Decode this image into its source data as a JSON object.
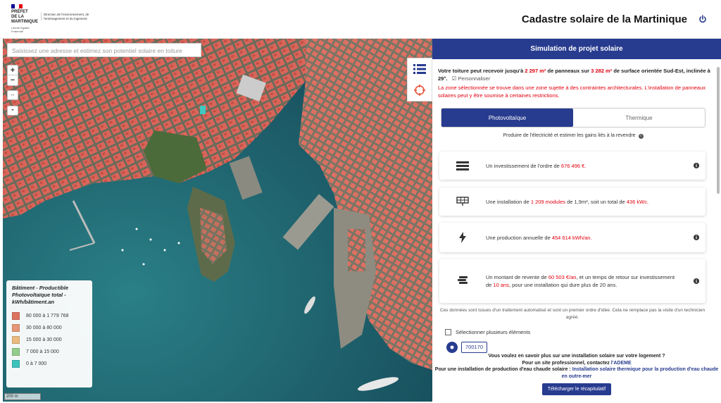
{
  "header": {
    "logo_line1": "PRÉFET",
    "logo_line2": "DE LA",
    "logo_line3": "MARTINIQUE",
    "logo_motto": "Liberté Égalité Fraternité",
    "logo_direction": "Direction de l'environnement, de l'aménagement et du logement",
    "title": "Cadastre solaire de la Martinique"
  },
  "map": {
    "search_placeholder": "Saisissez une adresse et estimez son potentiel solaire en toiture",
    "zoom_in": "+",
    "zoom_out": "−",
    "scale": "200 m",
    "legend": {
      "title": "Bâtiment - Productible Photovoltaïque total - kWh/bâtiment.an",
      "items": [
        {
          "label": "80 000 à 1 779 768",
          "color": "#e8735f"
        },
        {
          "label": "30 000 à 80 000",
          "color": "#f09a78"
        },
        {
          "label": "15 000 à 30 000",
          "color": "#f5bf80"
        },
        {
          "label": "7 000 à 15 000",
          "color": "#9bd28c"
        },
        {
          "label": "0 à 7 000",
          "color": "#3ec8c0"
        }
      ]
    }
  },
  "panel": {
    "title": "Simulation de projet solaire",
    "intro_prefix": "Votre toiture peut recevoir jusqu'à",
    "panels_area": "2 297 m²",
    "intro_mid": "de panneaux sur",
    "surface_area": "3 282 m²",
    "intro_suffix": "de surface orientée Sud-Est, inclinée à 29°.",
    "personalize": "Personnaliser",
    "warning": "La zone sélectionnée se trouve dans une zone sujette à des contraintes architecturales. L'installation de panneaux solaires peut y être soumise à certaines restrictions.",
    "tabs": [
      {
        "label": "Photovoltaïque"
      },
      {
        "label": "Thermique"
      }
    ],
    "tab_desc": "Produire de l'électricité et estimer les gains liés à la revendre",
    "cards": {
      "investment": {
        "prefix": "Un investissement de l'ordre de",
        "value": "676 496 €."
      },
      "installation": {
        "prefix": "Une installation de",
        "value1": "1 209 modules",
        "mid": "de 1,9m², soit un total de",
        "value2": "436 kWc."
      },
      "production": {
        "prefix": "Une production annuelle de",
        "value": "454 614 kWh/an."
      },
      "resale": {
        "prefix": "Un montant de revente de",
        "value1": "60 503 €/an",
        "mid": ", et un temps de retour sur investissement de",
        "value2": "10 ans",
        "suffix": ", pour une installation qui dure plus de 20 ans."
      }
    },
    "note": "Ces données sont issues d'un traitement automatisé et sont un premier ordre d'idée. Cela ne remplace pas la visite d'un technicien agréé.",
    "checkbox_label": "Sélectionner plusieurs éléments",
    "building_id": "700170",
    "footer": {
      "line1": "Vous voulez en savoir plus sur une installation solaire sur votre logement ?",
      "line2_prefix": "Pour un site professionnel, contactez",
      "line2_link": "l'ADEME",
      "line3_prefix": "Pour une installation de production d'eau chaude solaire :",
      "line3_link": "Installation solaire thermique pour la production d'eau chaude en outre-mer",
      "button": "Télécharger le récapitulatif"
    }
  },
  "colors": {
    "primary": "#273b8f",
    "highlight": "#e1000f"
  }
}
